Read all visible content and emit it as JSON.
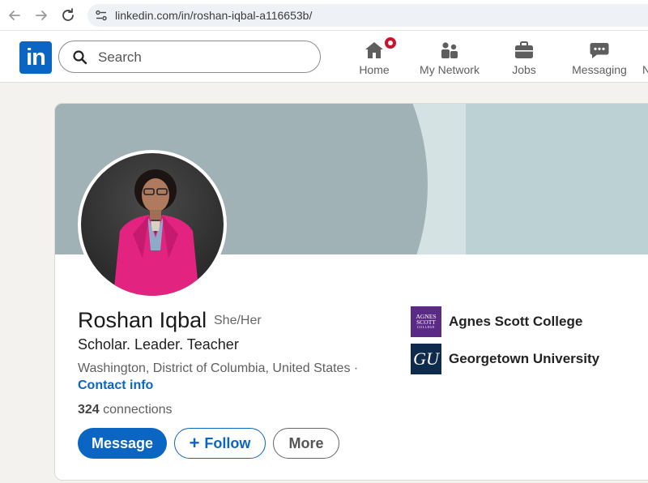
{
  "browser": {
    "url": "linkedin.com/in/roshan-iqbal-a116653b/"
  },
  "header": {
    "logo_text": "in",
    "search_placeholder": "Search",
    "nav": [
      {
        "label": "Home",
        "icon": "home-icon"
      },
      {
        "label": "My Network",
        "icon": "people-icon"
      },
      {
        "label": "Jobs",
        "icon": "briefcase-icon"
      },
      {
        "label": "Messaging",
        "icon": "chat-icon"
      }
    ],
    "nav_overflow_label": "N"
  },
  "profile": {
    "name": "Roshan Iqbal",
    "pronouns": "She/Her",
    "headline": "Scholar. Leader. Teacher",
    "location": "Washington, District of Columbia, United States ·",
    "contact_info": "Contact info",
    "connections_count": "324",
    "connections_label": "connections",
    "buttons": {
      "message": "Message",
      "follow": "Follow",
      "more": "More"
    },
    "education": [
      {
        "name": "Agnes Scott College",
        "logo_text": "AGNES SCOTT",
        "logo_sub": "COLLEGE",
        "logo_color": "#5b2a86"
      },
      {
        "name": "Georgetown University",
        "logo_text": "GU",
        "logo_color": "#0e2a4d"
      }
    ]
  },
  "colors": {
    "brand": "#0a66c2",
    "badge": "#cb112d",
    "banner": "#a0b2b5"
  }
}
